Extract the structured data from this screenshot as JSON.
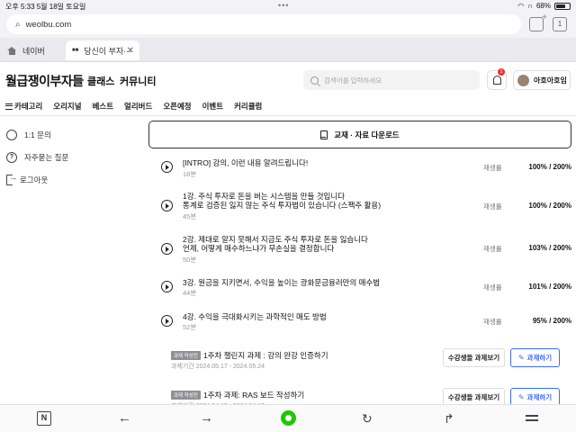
{
  "statusbar": {
    "time_date": "오후 5:33   5월 18일 토요일",
    "battery_text": "68%",
    "battery_level": 0.68,
    "dots": "•••"
  },
  "browser": {
    "url": "weolbu.com",
    "tab_count": "1",
    "tabs": [
      {
        "label": "네이버"
      },
      {
        "label": "당신이 부자···"
      }
    ]
  },
  "header": {
    "brand": "월급쟁이부자들",
    "nav": [
      "클래스",
      "커뮤니티"
    ],
    "search_placeholder": "검색어를 입력하세요",
    "notification_count": "1",
    "username": "아호아호임"
  },
  "category_nav": [
    "카테고리",
    "오리지널",
    "베스트",
    "얼리버드",
    "오픈예정",
    "이벤트",
    "커리큘럼"
  ],
  "sidebar": [
    {
      "label": "1:1 문의",
      "icon": "chat-icon"
    },
    {
      "label": "자주묻는 질문",
      "icon": "help-icon"
    },
    {
      "label": "로그아웃",
      "icon": "logout-icon"
    }
  ],
  "download_button": "교재 · 자료 다운로드",
  "rate_label": "재생률",
  "lessons": [
    {
      "title": [
        "[INTRO] 강의, 이런 내용 알려드립니다!"
      ],
      "duration": "18분",
      "rate": "100% / 200%"
    },
    {
      "title": [
        "1강. 주식 투자로 돈을 버는 시스템을 만들 것입니다",
        "통계로 검증된 잃지 않는 주식 투자법이 있습니다 (스팩주 활용)"
      ],
      "duration": "45분",
      "rate": "100% / 200%"
    },
    {
      "title": [
        "2강. 제대로 알지 못해서 지금도 주식 투자로 돈을 잃습니다",
        "언제, 어떻게 매수하느냐가 무손실을 결정합니다"
      ],
      "duration": "50분",
      "rate": "103% / 200%"
    },
    {
      "title": [
        "3강. 원금을 지키면서, 수익을 높이는 광화문금융러만의 매수법"
      ],
      "duration": "44분",
      "rate": "101% / 200%"
    },
    {
      "title": [
        "4강. 수익을 극대화시키는 과학적인 매도 방법"
      ],
      "duration": "52분",
      "rate": "95% / 200%"
    }
  ],
  "tasks": [
    {
      "tag": "과제 작성전",
      "title": "1주차 챌린지 과제 : 강의 완강 인증하기",
      "period": "과제기간 2024.05.17 - 2024.05.24",
      "peer_button": "수강생들 과제보기",
      "do_button": "과제하기"
    },
    {
      "tag": "과제 작성전",
      "title": "1주차 과제: RAS 보드 작성하기",
      "period": "과제기간 2024.04.19 - 2024.04.19",
      "peer_button": "수강생들 과제보기",
      "do_button": "과제하기"
    }
  ],
  "toolbar": {
    "n_icon": "N",
    "back": "←",
    "forward": "→",
    "reload": "↻",
    "share": "↱"
  }
}
